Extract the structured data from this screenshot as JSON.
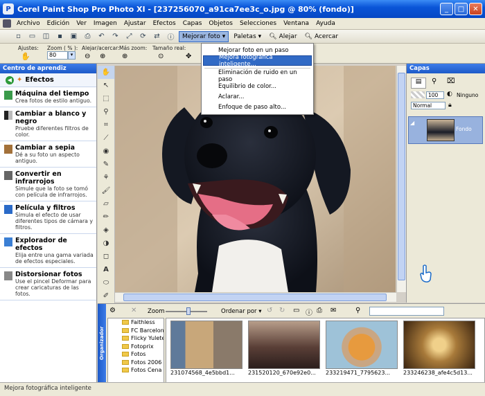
{
  "window": {
    "title": "Corel Paint Shop Pro Photo XI - [237256070_a91ca7ee3c_o.jpg @  80% (fondo)]"
  },
  "menu": [
    "Archivo",
    "Edición",
    "Ver",
    "Imagen",
    "Ajustar",
    "Efectos",
    "Capas",
    "Objetos",
    "Selecciones",
    "Ventana",
    "Ayuda"
  ],
  "toolbar": {
    "enhance_label": "Mejorar foto",
    "palettes_label": "Paletas",
    "zoom_out_label": "Alejar",
    "zoom_in_label": "Acercar"
  },
  "tool_options": {
    "presets_label": "Ajustes:",
    "zoom_label": "Zoom ( % ):",
    "zoom_value": "80",
    "zoom_out_label": "Alejar/acercar:",
    "zoom_more_label": "Más zoom:",
    "actual_size_label": "Tamaño real:"
  },
  "enhance_menu": {
    "items": [
      "Mejorar foto en un paso",
      "Mejora fotográfica inteligente...",
      "Eliminación de ruido en un paso",
      "Equilibrio de color...",
      "Aclarar...",
      "Enfoque de paso alto..."
    ],
    "highlighted": "Mejora fotográfica inteligente..."
  },
  "learning_center": {
    "title": "Centro de aprendiz",
    "section": "Efectos",
    "items": [
      {
        "title": "Máquina del tiempo",
        "desc": "Crea fotos de estilo antiguo."
      },
      {
        "title": "Cambiar a blanco y negro",
        "desc": "Pruebe diferentes filtros de color."
      },
      {
        "title": "Cambiar a sepia",
        "desc": "Dé a su foto un aspecto antiguo."
      },
      {
        "title": "Convertir en infrarrojos",
        "desc": "Simule que la foto se tomó con película de infrarrojos."
      },
      {
        "title": "Película y filtros",
        "desc": "Simula el efecto de usar diferentes tipos de cámara y filtros."
      },
      {
        "title": "Explorador de efectos",
        "desc": "Elija entre una gama variada de efectos especiales."
      },
      {
        "title": "Distorsionar fotos",
        "desc": "Use el pincel Deformar para crear caricaturas de las fotos."
      }
    ]
  },
  "layers": {
    "title": "Capas",
    "opacity": "100",
    "blend_mode": "Normal",
    "mask": "Ninguno",
    "layer_name": "Fondo"
  },
  "organizer": {
    "side_label": "Organizador",
    "zoom_label": "Zoom",
    "sort_label": "Ordenar por",
    "folders": [
      "Faithless",
      "FC Barcelona",
      "Flicky Yulete",
      "Fotoprix",
      "Fotos",
      "Fotos 2006",
      "Fotos Cena"
    ],
    "thumbnails": [
      "231074568_4e5bbd1...",
      "231520120_670e92e0...",
      "233219471_7795623...",
      "233246238_afe4c5d13..."
    ]
  },
  "status": {
    "text": "Mejora fotográfica inteligente"
  },
  "colors": {
    "title_bar": "#0a55d8",
    "panel_header": "#3d7ce8",
    "highlight": "#316ac5"
  }
}
